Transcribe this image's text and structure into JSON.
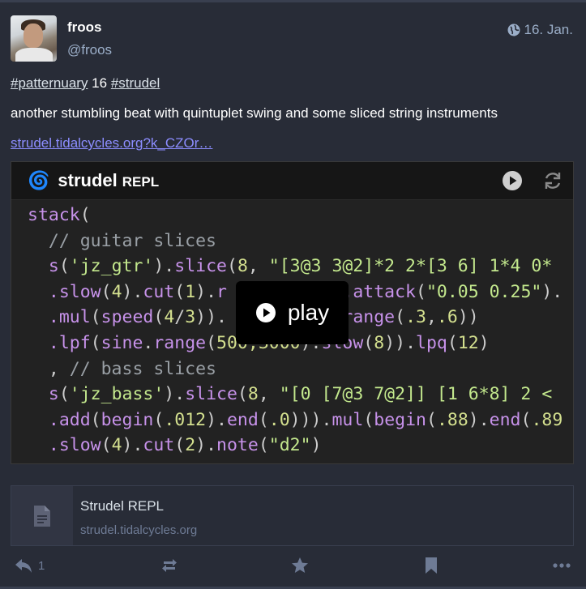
{
  "post": {
    "display_name": "froos",
    "handle": "@froos",
    "date": "16. Jan.",
    "hashtag1": "#patternuary",
    "number": " 16 ",
    "hashtag2": "#strudel",
    "text": "another stumbling beat with quintuplet swing and some sliced string instruments",
    "link": "strudel.tidalcycles.org?k_CZOr…"
  },
  "embed": {
    "brand": "strudel",
    "brand_sub": "REPL",
    "play_label": "play",
    "code": [
      [
        [
          "m",
          "stack"
        ],
        [
          "p",
          "("
        ]
      ],
      [
        [
          "c",
          "  // guitar slices"
        ]
      ],
      [
        [
          "m",
          "  s"
        ],
        [
          "p",
          "("
        ],
        [
          "s",
          "'jz_gtr'"
        ],
        [
          "p",
          ")."
        ],
        [
          "m",
          "slice"
        ],
        [
          "p",
          "("
        ],
        [
          "n",
          "8"
        ],
        [
          "p",
          ", "
        ],
        [
          "s",
          "\"[3@3 3@2]*2 2*[3 6] 1*4 0*"
        ]
      ],
      [
        [
          "m",
          "  .slow"
        ],
        [
          "p",
          "("
        ],
        [
          "n",
          "4"
        ],
        [
          "p",
          ")."
        ],
        [
          "m",
          "cut"
        ],
        [
          "p",
          "("
        ],
        [
          "n",
          "1"
        ],
        [
          "p",
          ")."
        ],
        [
          "m",
          "r           "
        ],
        [
          "m",
          ".attack"
        ],
        [
          "p",
          "("
        ],
        [
          "s",
          "\"0.05 0.25\""
        ],
        [
          "p",
          ")."
        ]
      ],
      [
        [
          "m",
          "  .mul"
        ],
        [
          "p",
          "("
        ],
        [
          "m",
          "speed"
        ],
        [
          "p",
          "("
        ],
        [
          "n",
          "4"
        ],
        [
          "p",
          "/"
        ],
        [
          "n",
          "3"
        ],
        [
          "p",
          ")).           "
        ],
        [
          "m",
          "range"
        ],
        [
          "p",
          "("
        ],
        [
          "n",
          ".3"
        ],
        [
          "p",
          ","
        ],
        [
          "n",
          ".6"
        ],
        [
          "p",
          "))"
        ]
      ],
      [
        [
          "m",
          "  .lpf"
        ],
        [
          "p",
          "("
        ],
        [
          "m",
          "sine"
        ],
        [
          "p",
          "."
        ],
        [
          "m",
          "range"
        ],
        [
          "p",
          "("
        ],
        [
          "n",
          "500,3000"
        ],
        [
          "p",
          ")."
        ],
        [
          "m",
          "slow"
        ],
        [
          "p",
          "("
        ],
        [
          "n",
          "8"
        ],
        [
          "p",
          "))."
        ],
        [
          "m",
          "lpq"
        ],
        [
          "p",
          "("
        ],
        [
          "n",
          "12"
        ],
        [
          "p",
          ")"
        ]
      ],
      [
        [
          "p",
          "  , "
        ],
        [
          "c",
          "// bass slices"
        ]
      ],
      [
        [
          "m",
          "  s"
        ],
        [
          "p",
          "("
        ],
        [
          "s",
          "'jz_bass'"
        ],
        [
          "p",
          ")."
        ],
        [
          "m",
          "slice"
        ],
        [
          "p",
          "("
        ],
        [
          "n",
          "8"
        ],
        [
          "p",
          ", "
        ],
        [
          "s",
          "\"[0 [7@3 7@2]] [1 6*8] 2 <"
        ]
      ],
      [
        [
          "m",
          "  .add"
        ],
        [
          "p",
          "("
        ],
        [
          "m",
          "begin"
        ],
        [
          "p",
          "("
        ],
        [
          "n",
          ".012"
        ],
        [
          "p",
          ")."
        ],
        [
          "m",
          "end"
        ],
        [
          "p",
          "("
        ],
        [
          "n",
          ".0"
        ],
        [
          "p",
          ")))."
        ],
        [
          "m",
          "mul"
        ],
        [
          "p",
          "("
        ],
        [
          "m",
          "begin"
        ],
        [
          "p",
          "("
        ],
        [
          "n",
          ".88"
        ],
        [
          "p",
          ")."
        ],
        [
          "m",
          "end"
        ],
        [
          "p",
          "("
        ],
        [
          "n",
          ".89"
        ]
      ],
      [
        [
          "m",
          "  .slow"
        ],
        [
          "p",
          "("
        ],
        [
          "n",
          "4"
        ],
        [
          "p",
          ")."
        ],
        [
          "m",
          "cut"
        ],
        [
          "p",
          "("
        ],
        [
          "n",
          "2"
        ],
        [
          "p",
          ")."
        ],
        [
          "m",
          "note"
        ],
        [
          "p",
          "("
        ],
        [
          "s",
          "\"d2\""
        ],
        [
          "p",
          ")"
        ]
      ]
    ]
  },
  "card": {
    "title": "Strudel REPL",
    "domain": "strudel.tidalcycles.org"
  },
  "actions": {
    "reply_count": "1"
  },
  "icons": [
    "globe-icon",
    "play-circle-icon",
    "refresh-icon",
    "document-icon",
    "reply-icon",
    "boost-icon",
    "star-icon",
    "bookmark-icon",
    "more-icon"
  ],
  "colors": {
    "link": "#8c8dff",
    "accent": "#3ea6ff"
  }
}
